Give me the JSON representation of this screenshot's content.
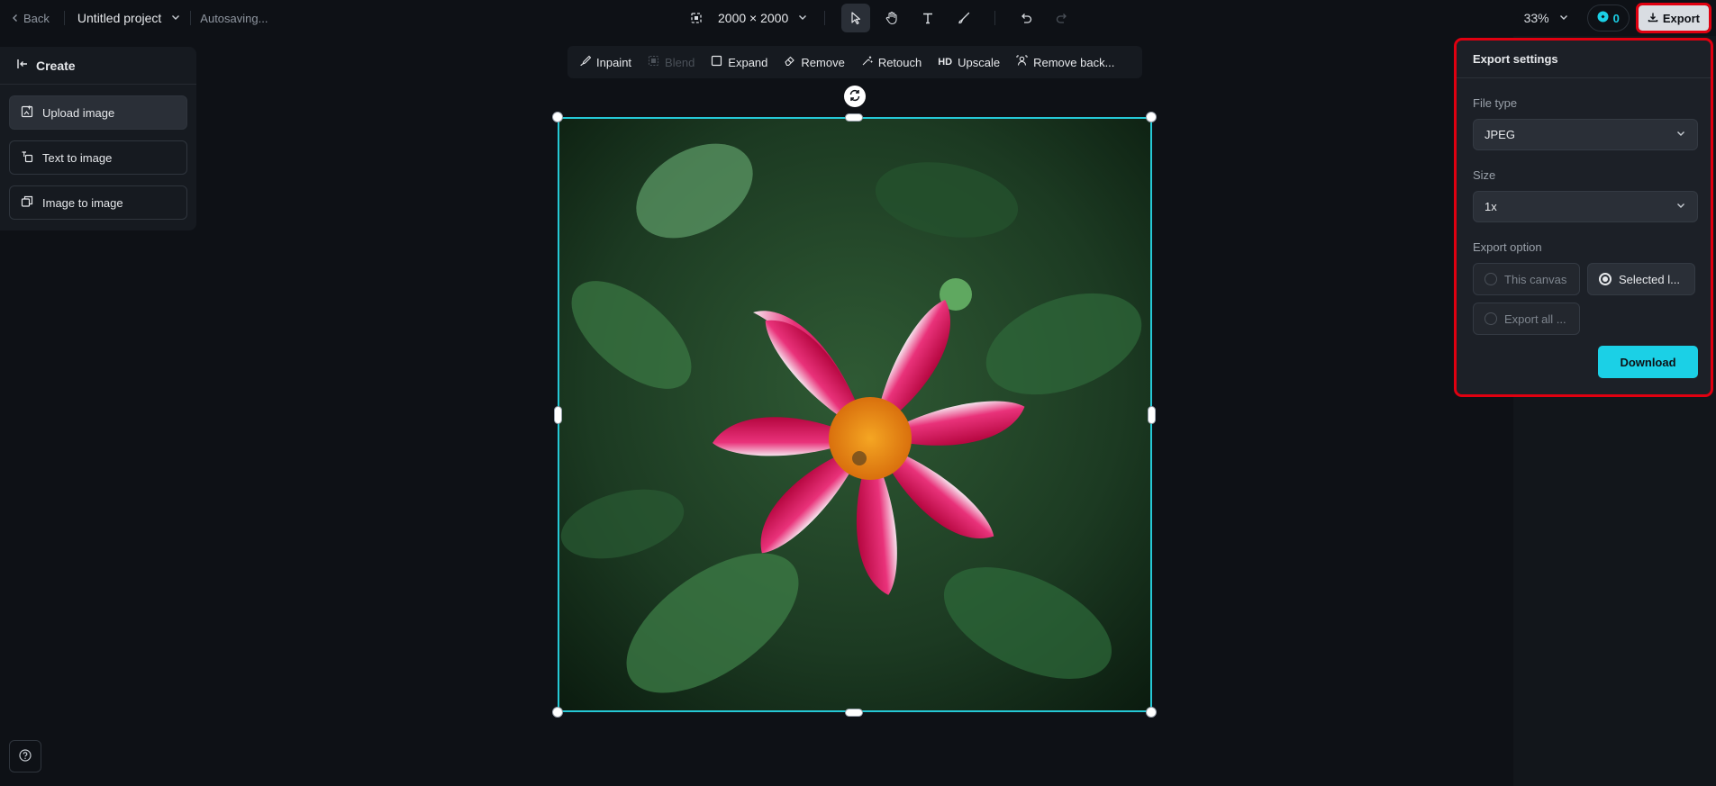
{
  "topbar": {
    "back_label": "Back",
    "project_name": "Untitled project",
    "status": "Autosaving...",
    "canvas_size": "2000 × 2000",
    "zoom": "33%",
    "credits": "0",
    "export_label": "Export"
  },
  "sidebar": {
    "title": "Create",
    "items": [
      {
        "label": "Upload image",
        "icon": "upload-image-icon"
      },
      {
        "label": "Text to image",
        "icon": "text-to-image-icon"
      },
      {
        "label": "Image to image",
        "icon": "image-to-image-icon"
      }
    ]
  },
  "edit_toolbar": {
    "items": [
      {
        "label": "Inpaint",
        "icon": "inpaint-icon",
        "enabled": true
      },
      {
        "label": "Blend",
        "icon": "blend-icon",
        "enabled": false
      },
      {
        "label": "Expand",
        "icon": "expand-icon",
        "enabled": true
      },
      {
        "label": "Remove",
        "icon": "eraser-icon",
        "enabled": true
      },
      {
        "label": "Retouch",
        "icon": "retouch-icon",
        "enabled": true
      },
      {
        "label": "Upscale",
        "icon": "hd-icon",
        "icon_text": "HD",
        "enabled": true
      },
      {
        "label": "Remove back...",
        "icon": "remove-background-icon",
        "enabled": true
      }
    ]
  },
  "export_panel": {
    "title": "Export settings",
    "file_type_label": "File type",
    "file_type_value": "JPEG",
    "size_label": "Size",
    "size_value": "1x",
    "export_option_label": "Export option",
    "options": [
      {
        "label": "This canvas",
        "selected": false
      },
      {
        "label": "Selected l...",
        "selected": true
      },
      {
        "label": "Export all ...",
        "selected": false
      }
    ],
    "download_label": "Download"
  },
  "colors": {
    "accent": "#1bd0e6",
    "selection": "#25c8d6",
    "highlight": "#e00010",
    "background": "#0e1116"
  }
}
